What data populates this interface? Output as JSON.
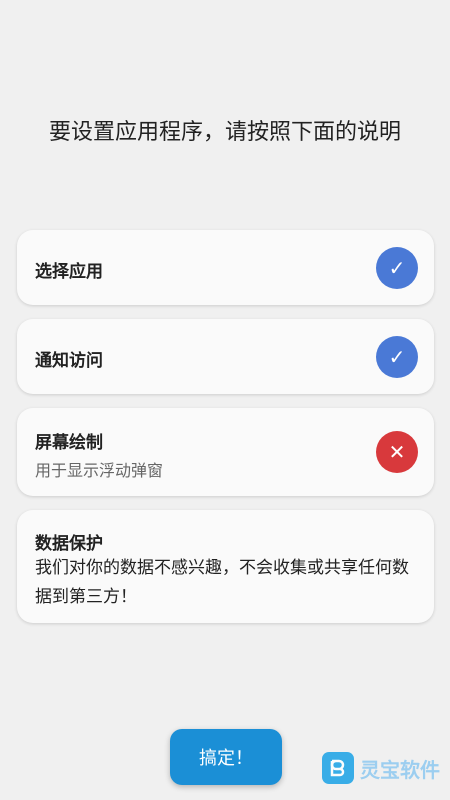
{
  "header": {
    "title": "要设置应用程序，请按照下面的说明"
  },
  "cards": [
    {
      "title": "选择应用",
      "status": "ok",
      "icon": "✓"
    },
    {
      "title": "通知访问",
      "status": "ok",
      "icon": "✓"
    },
    {
      "title": "屏幕绘制",
      "subtitle": "用于显示浮动弹窗",
      "status": "error",
      "icon": "✕"
    }
  ],
  "privacy": {
    "title": "数据保护",
    "body": "我们对你的数据不感兴趣，不会收集或共享任何数据到第三方！"
  },
  "action": {
    "label": "搞定！"
  },
  "watermark": {
    "text": "灵宝软件"
  },
  "colors": {
    "background": "#f0f0f0",
    "ok": "#4a79d6",
    "error": "#d8393c",
    "button": "#1b8fd6"
  }
}
